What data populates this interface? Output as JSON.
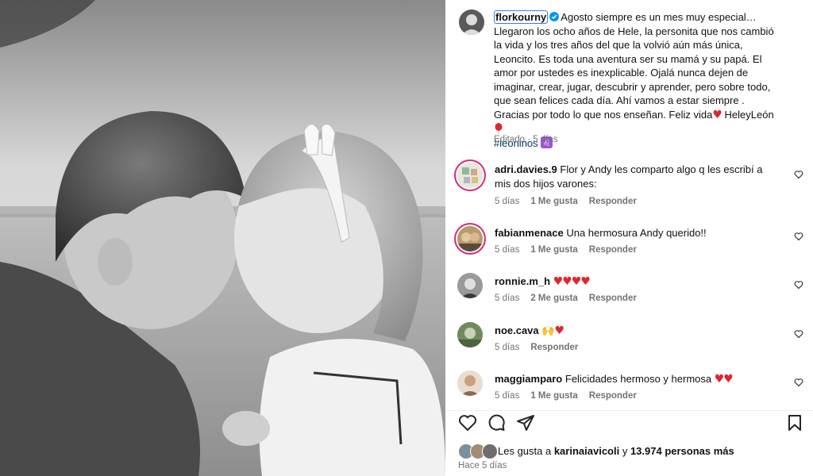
{
  "post": {
    "owner": "florkourny",
    "caption_text": "Agosto siempre es un mes muy especial… Llegaron los ocho años de Hele, la personita que nos cambió la vida y los tres años del que la volvió aún más única, Leoncito. Es toda una aventura ser su mamá y su papá. El amor por ustedes es inexplicable. Ojalá nunca dejen de imaginar, crear, jugar, descubrir y aprender, pero sobre todo, que sean felices cada día. Ahí vamos a estar siempre . Gracias por todo lo que nos enseñan. Feliz vida",
    "caption_tail": " HeleyLeón ",
    "hashtag": "#leoninos",
    "edited": "Editado",
    "edited_time": "5 días",
    "icons": {
      "verified": "verified-badge-icon",
      "caption_heart": "red-heart-icon",
      "balloon": "red-balloon-icon",
      "zodiac": "leo-sign-icon"
    }
  },
  "comments": [
    {
      "user": "adri.davies.9",
      "text": "Flor y Andy les comparto algo q les escribí a mis dos hijos varones:",
      "time": "5 días",
      "likes": "1 Me gusta",
      "reply": "Responder"
    },
    {
      "user": "fabianmenace",
      "text": "Una hermosura Andy querido!!",
      "time": "5 días",
      "likes": "1 Me gusta",
      "reply": "Responder"
    },
    {
      "user": "ronnie.m_h",
      "text": "",
      "hearts": "♥♥♥♥",
      "time": "5 días",
      "likes": "2 Me gusta",
      "reply": "Responder"
    },
    {
      "user": "noe.cava",
      "text": "",
      "emojis": "🙌",
      "hearts": "♥",
      "time": "5 días",
      "likes": "",
      "reply": "Responder"
    },
    {
      "user": "maggiamparo",
      "text": "Felicidades hermoso y hermosa",
      "hearts": "♥♥",
      "time": "5 días",
      "likes": "1 Me gusta",
      "reply": "Responder"
    }
  ],
  "actions": {
    "like_icon": "heart-outline-icon",
    "comment_icon": "comment-bubble-icon",
    "share_icon": "paper-plane-icon",
    "save_icon": "bookmark-icon"
  },
  "likes": {
    "prefix": "Les gusta a ",
    "user": "karinaiavicoli",
    "middle": " y ",
    "count": "13.974 personas más"
  },
  "timestamp": "Hace 5 días",
  "colors": {
    "hashtag": "#00376b",
    "muted": "#737373",
    "heart": "#e0262f",
    "story_ring": "#d62976",
    "focus_outline": "#3b7ddd"
  }
}
